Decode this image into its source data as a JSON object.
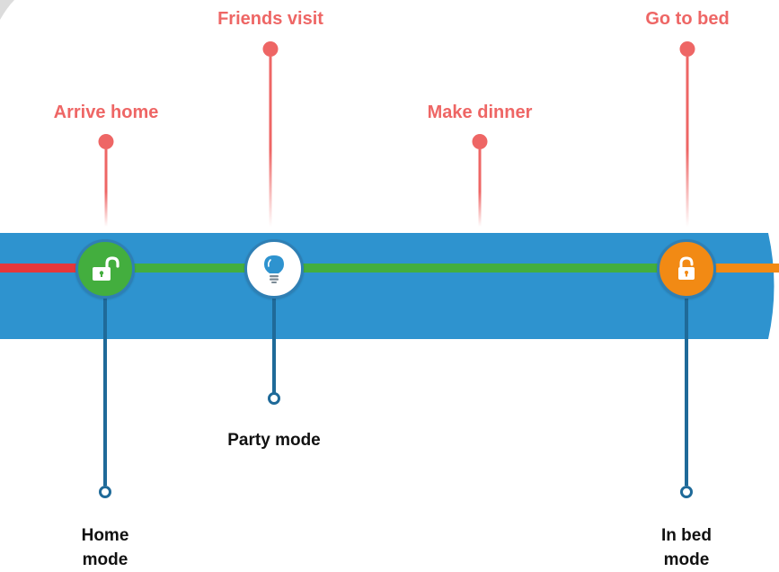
{
  "colors": {
    "band": "#2e93cf",
    "band_dark": "#267fb6",
    "track_start": "#e5373a",
    "track_middle": "#43ae3e",
    "track_end": "#f28a14",
    "event": "#ee6665",
    "mode_stem": "#1f6a99",
    "node_home": "#43ae3e",
    "node_party": "#ffffff",
    "node_bed": "#f28a14"
  },
  "events": [
    {
      "label": "Arrive home",
      "icon": "dot-marker"
    },
    {
      "label": "Friends visit",
      "icon": "dot-marker"
    },
    {
      "label": "Make dinner",
      "icon": "dot-marker"
    },
    {
      "label": "Go to bed",
      "icon": "dot-marker"
    }
  ],
  "modes": [
    {
      "label": "Home\nmode",
      "icon": "unlock-icon"
    },
    {
      "label": "Party mode",
      "icon": "light-bulb-icon"
    },
    {
      "label": "In bed\nmode",
      "icon": "unlock-icon"
    }
  ]
}
